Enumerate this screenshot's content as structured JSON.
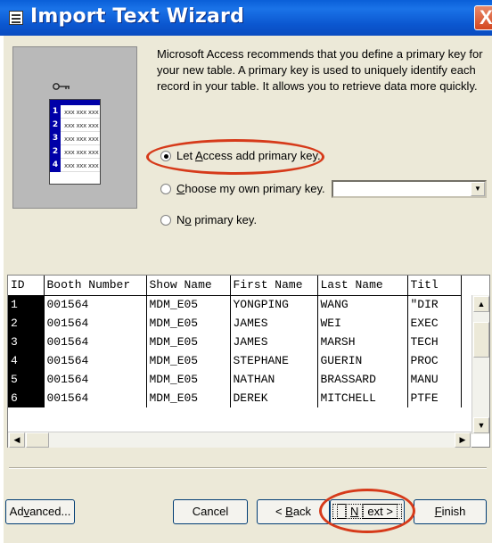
{
  "window": {
    "title": "Import Text Wizard",
    "close_label": "X"
  },
  "description": "Microsoft Access recommends that you define a primary key for your new table. A primary key is used to uniquely identify each record in your table. It allows you to retrieve data more quickly.",
  "illustration": {
    "row_numbers": [
      "1",
      "2",
      "3",
      "2",
      "4"
    ],
    "cell_text": "xxx xxx xxx"
  },
  "options": [
    {
      "before": "Let ",
      "mnemonic": "A",
      "after": "ccess add primary key.",
      "selected": true
    },
    {
      "before": "",
      "mnemonic": "C",
      "after": "hoose my own primary key.",
      "selected": false
    },
    {
      "before": "N",
      "mnemonic": "o",
      "after": " primary key.",
      "selected": false
    }
  ],
  "key_field_select": {
    "value": ""
  },
  "table": {
    "columns": [
      "ID",
      "Booth Number",
      "Show Name",
      "First Name",
      "Last Name",
      "Titl"
    ],
    "rows": [
      [
        "1",
        "001564",
        "MDM_E05",
        "YONGPING",
        "WANG",
        "\"DIR"
      ],
      [
        "2",
        "001564",
        "MDM_E05",
        "JAMES",
        "WEI",
        "EXEC"
      ],
      [
        "3",
        "001564",
        "MDM_E05",
        "JAMES",
        "MARSH",
        "TECH"
      ],
      [
        "4",
        "001564",
        "MDM_E05",
        "STEPHANE",
        "GUERIN",
        "PROC"
      ],
      [
        "5",
        "001564",
        "MDM_E05",
        "NATHAN",
        "BRASSARD",
        "MANU"
      ],
      [
        "6",
        "001564",
        "MDM_E05",
        "DEREK",
        "MITCHELL",
        "PTFE"
      ]
    ]
  },
  "buttons": {
    "advanced": {
      "before": "Ad",
      "mnemonic": "v",
      "after": "anced..."
    },
    "cancel": "Cancel",
    "back": {
      "before": "< ",
      "mnemonic": "B",
      "after": "ack"
    },
    "next": {
      "before": "",
      "mnemonic": "N",
      "after": "ext >"
    },
    "finish": {
      "before": "",
      "mnemonic": "F",
      "after": "inish"
    }
  },
  "colors": {
    "titlebar": "#0b56cf",
    "dialog_bg": "#ece9d8",
    "highlight": "#d63a1a",
    "id_column": "#000000"
  }
}
